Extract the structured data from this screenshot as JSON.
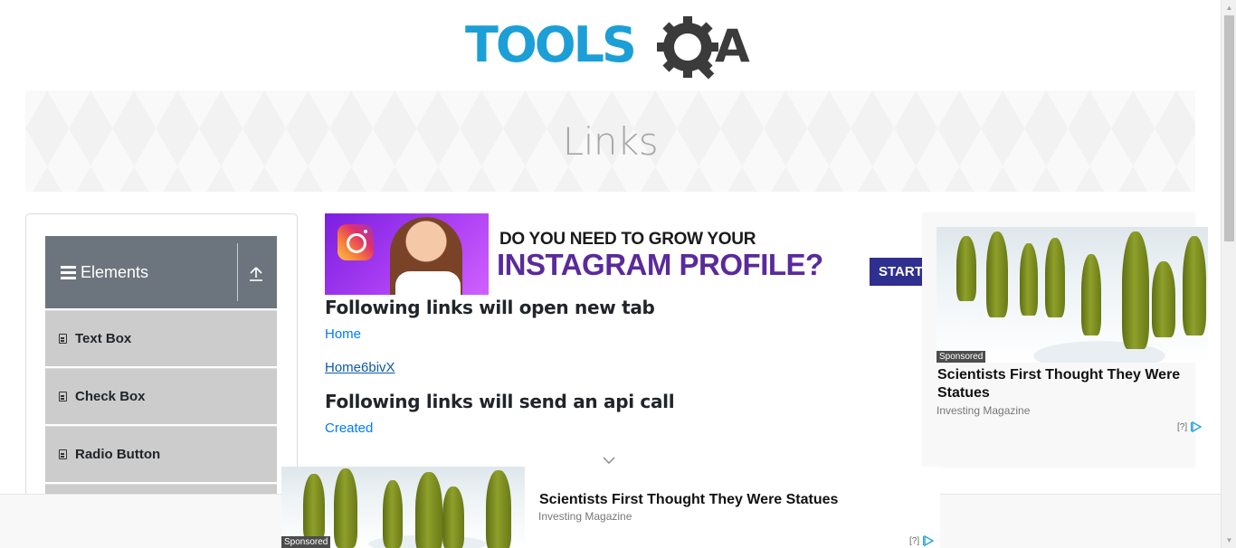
{
  "logo": {
    "part1": "TOOLS",
    "part2": "QA"
  },
  "banner": {
    "title": "Links"
  },
  "sidebar": {
    "group_title": "Elements",
    "items": [
      {
        "label": "Text Box"
      },
      {
        "label": "Check Box"
      },
      {
        "label": "Radio Button"
      }
    ]
  },
  "top_ad": {
    "line1": "DO YOU NEED TO GROW YOUR",
    "line2": "INSTAGRAM PROFILE?",
    "cta": "START"
  },
  "content": {
    "section1_title": "Following links will open new tab",
    "link_home": "Home",
    "link_dynamic": "Home6bivX",
    "section2_title": "Following links will send an api call",
    "link_created": "Created"
  },
  "right_ad": {
    "sponsored": "Sponsored",
    "headline": "Scientists First Thought They Were Statues",
    "source": "Investing Magazine",
    "adchoices": "[?]"
  },
  "bottom_ad": {
    "sponsored": "Sponsored",
    "headline": "Scientists First Thought They Were Statues",
    "source": "Investing Magazine",
    "adchoices": "[?]"
  },
  "colors": {
    "logo_blue": "#1b9fd6",
    "logo_dark": "#3b3b3b",
    "sidebar_header": "#6c757d",
    "menu_item_bg": "#cccccc",
    "link": "#007bff"
  }
}
